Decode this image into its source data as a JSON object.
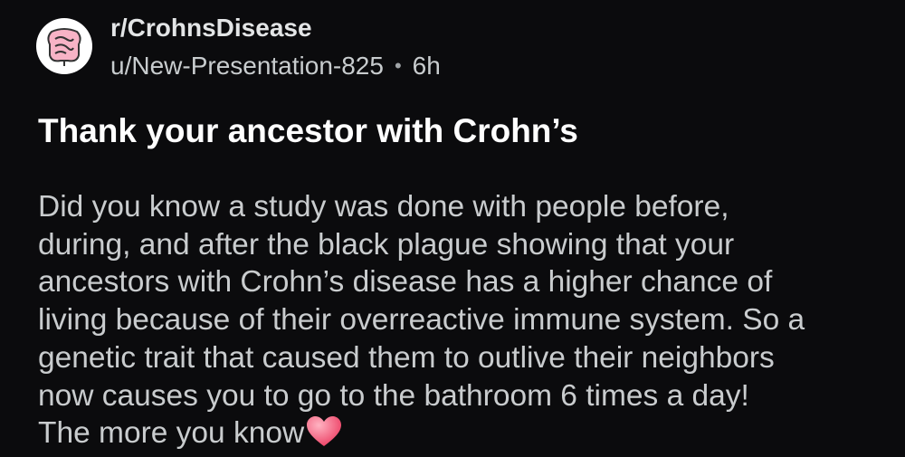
{
  "header": {
    "subreddit": "r/CrohnsDisease",
    "author": "u/New-Presentation-825",
    "separator": "•",
    "time_ago": "6h",
    "avatar_icon": "intestine-icon"
  },
  "post": {
    "title": "Thank your ancestor with Crohn’s",
    "body_lines": [
      "Did you know a study was done with people before,",
      "during, and after the black plague showing that your",
      "ancestors with Crohn’s disease has a higher chance of",
      "living because of their overreactive immune system. So a",
      "genetic trait that caused them to outlive their neighbors",
      "now causes you to go to the bathroom 6 times a day!",
      "The more you know"
    ],
    "emoji": "heart-icon"
  },
  "colors": {
    "background": "#0b0b0d",
    "text": "#c9ccce",
    "title": "#ffffff",
    "heart": "#f25f7a"
  }
}
